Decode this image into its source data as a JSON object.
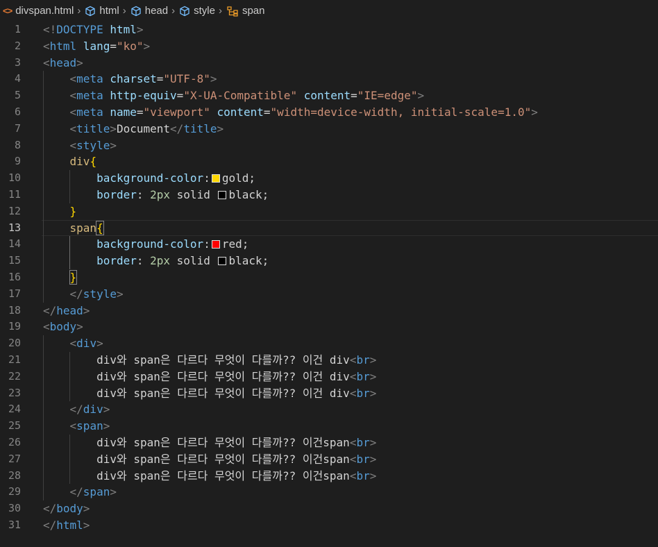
{
  "breadcrumb": {
    "file": "divspan.html",
    "items": [
      "html",
      "head",
      "style",
      "span"
    ]
  },
  "lines": [
    {
      "n": "1",
      "tokens": [
        [
          "t",
          "<!"
        ],
        [
          "tag",
          "DOCTYPE"
        ],
        [
          "attr",
          " html"
        ],
        [
          "t",
          ">"
        ]
      ]
    },
    {
      "n": "2",
      "tokens": [
        [
          "t",
          "<"
        ],
        [
          "tag",
          "html"
        ],
        [
          "attr",
          " lang"
        ],
        [
          "txt",
          "="
        ],
        [
          "str",
          "\"ko\""
        ],
        [
          "t",
          ">"
        ]
      ]
    },
    {
      "n": "3",
      "tokens": [
        [
          "t",
          "<"
        ],
        [
          "tag",
          "head"
        ],
        [
          "t",
          ">"
        ]
      ]
    },
    {
      "n": "4",
      "tokens": [
        [
          "txt",
          "    "
        ],
        [
          "t",
          "<"
        ],
        [
          "tag",
          "meta"
        ],
        [
          "attr",
          " charset"
        ],
        [
          "txt",
          "="
        ],
        [
          "str",
          "\"UTF-8\""
        ],
        [
          "t",
          ">"
        ]
      ]
    },
    {
      "n": "5",
      "tokens": [
        [
          "txt",
          "    "
        ],
        [
          "t",
          "<"
        ],
        [
          "tag",
          "meta"
        ],
        [
          "attr",
          " http-equiv"
        ],
        [
          "txt",
          "="
        ],
        [
          "str",
          "\"X-UA-Compatible\""
        ],
        [
          "attr",
          " content"
        ],
        [
          "txt",
          "="
        ],
        [
          "str",
          "\"IE=edge\""
        ],
        [
          "t",
          ">"
        ]
      ]
    },
    {
      "n": "6",
      "tokens": [
        [
          "txt",
          "    "
        ],
        [
          "t",
          "<"
        ],
        [
          "tag",
          "meta"
        ],
        [
          "attr",
          " name"
        ],
        [
          "txt",
          "="
        ],
        [
          "str",
          "\"viewport\""
        ],
        [
          "attr",
          " content"
        ],
        [
          "txt",
          "="
        ],
        [
          "str",
          "\"width=device-width, initial-scale=1.0\""
        ],
        [
          "t",
          ">"
        ]
      ]
    },
    {
      "n": "7",
      "tokens": [
        [
          "txt",
          "    "
        ],
        [
          "t",
          "<"
        ],
        [
          "tag",
          "title"
        ],
        [
          "t",
          ">"
        ],
        [
          "txt",
          "Document"
        ],
        [
          "t",
          "</"
        ],
        [
          "tag",
          "title"
        ],
        [
          "t",
          ">"
        ]
      ]
    },
    {
      "n": "8",
      "tokens": [
        [
          "txt",
          "    "
        ],
        [
          "t",
          "<"
        ],
        [
          "tag",
          "style"
        ],
        [
          "t",
          ">"
        ]
      ]
    },
    {
      "n": "9",
      "tokens": [
        [
          "txt",
          "    "
        ],
        [
          "sel",
          "div"
        ],
        [
          "br1",
          "{"
        ]
      ]
    },
    {
      "n": "10",
      "tokens": [
        [
          "txt",
          "        "
        ],
        [
          "prop",
          "background-color"
        ],
        [
          "txt",
          ":"
        ],
        [
          "swatch",
          "#ffd700"
        ],
        [
          "txt",
          "gold;"
        ]
      ]
    },
    {
      "n": "11",
      "tokens": [
        [
          "txt",
          "        "
        ],
        [
          "prop",
          "border"
        ],
        [
          "txt",
          ": "
        ],
        [
          "num",
          "2px"
        ],
        [
          "txt",
          " solid "
        ],
        [
          "swatch",
          "#000000"
        ],
        [
          "txt",
          "black;"
        ]
      ]
    },
    {
      "n": "12",
      "tokens": [
        [
          "txt",
          "    "
        ],
        [
          "br1",
          "}"
        ]
      ]
    },
    {
      "n": "13",
      "tokens": [
        [
          "txt",
          "    "
        ],
        [
          "sel",
          "span"
        ],
        [
          "br1m",
          "{"
        ]
      ]
    },
    {
      "n": "14",
      "tokens": [
        [
          "txt",
          "        "
        ],
        [
          "prop",
          "background-color"
        ],
        [
          "txt",
          ":"
        ],
        [
          "swatch",
          "#ff0000"
        ],
        [
          "txt",
          "red;"
        ]
      ]
    },
    {
      "n": "15",
      "tokens": [
        [
          "txt",
          "        "
        ],
        [
          "prop",
          "border"
        ],
        [
          "txt",
          ": "
        ],
        [
          "num",
          "2px"
        ],
        [
          "txt",
          " solid "
        ],
        [
          "swatch",
          "#000000"
        ],
        [
          "txt",
          "black;"
        ]
      ]
    },
    {
      "n": "16",
      "tokens": [
        [
          "txt",
          "    "
        ],
        [
          "br1m",
          "}"
        ]
      ]
    },
    {
      "n": "17",
      "tokens": [
        [
          "txt",
          "    "
        ],
        [
          "t",
          "</"
        ],
        [
          "tag",
          "style"
        ],
        [
          "t",
          ">"
        ]
      ]
    },
    {
      "n": "18",
      "tokens": [
        [
          "t",
          "</"
        ],
        [
          "tag",
          "head"
        ],
        [
          "t",
          ">"
        ]
      ]
    },
    {
      "n": "19",
      "tokens": [
        [
          "t",
          "<"
        ],
        [
          "tag",
          "body"
        ],
        [
          "t",
          ">"
        ]
      ]
    },
    {
      "n": "20",
      "tokens": [
        [
          "txt",
          "    "
        ],
        [
          "t",
          "<"
        ],
        [
          "tag",
          "div"
        ],
        [
          "t",
          ">"
        ]
      ]
    },
    {
      "n": "21",
      "tokens": [
        [
          "txt",
          "        div와 span은 다르다 무엇이 다를까?? 이건 div"
        ],
        [
          "t",
          "<"
        ],
        [
          "tag",
          "br"
        ],
        [
          "t",
          ">"
        ]
      ]
    },
    {
      "n": "22",
      "tokens": [
        [
          "txt",
          "        div와 span은 다르다 무엇이 다를까?? 이건 div"
        ],
        [
          "t",
          "<"
        ],
        [
          "tag",
          "br"
        ],
        [
          "t",
          ">"
        ]
      ]
    },
    {
      "n": "23",
      "tokens": [
        [
          "txt",
          "        div와 span은 다르다 무엇이 다를까?? 이건 div"
        ],
        [
          "t",
          "<"
        ],
        [
          "tag",
          "br"
        ],
        [
          "t",
          ">"
        ]
      ]
    },
    {
      "n": "24",
      "tokens": [
        [
          "txt",
          "    "
        ],
        [
          "t",
          "</"
        ],
        [
          "tag",
          "div"
        ],
        [
          "t",
          ">"
        ]
      ]
    },
    {
      "n": "25",
      "tokens": [
        [
          "txt",
          "    "
        ],
        [
          "t",
          "<"
        ],
        [
          "tag",
          "span"
        ],
        [
          "t",
          ">"
        ]
      ]
    },
    {
      "n": "26",
      "tokens": [
        [
          "txt",
          "        div와 span은 다르다 무엇이 다를까?? 이건span"
        ],
        [
          "t",
          "<"
        ],
        [
          "tag",
          "br"
        ],
        [
          "t",
          ">"
        ]
      ]
    },
    {
      "n": "27",
      "tokens": [
        [
          "txt",
          "        div와 span은 다르다 무엇이 다를까?? 이건span"
        ],
        [
          "t",
          "<"
        ],
        [
          "tag",
          "br"
        ],
        [
          "t",
          ">"
        ]
      ]
    },
    {
      "n": "28",
      "tokens": [
        [
          "txt",
          "        div와 span은 다르다 무엇이 다를까?? 이건span"
        ],
        [
          "t",
          "<"
        ],
        [
          "tag",
          "br"
        ],
        [
          "t",
          ">"
        ]
      ]
    },
    {
      "n": "29",
      "tokens": [
        [
          "txt",
          "    "
        ],
        [
          "t",
          "</"
        ],
        [
          "tag",
          "span"
        ],
        [
          "t",
          ">"
        ]
      ]
    },
    {
      "n": "30",
      "tokens": [
        [
          "t",
          "</"
        ],
        [
          "tag",
          "body"
        ],
        [
          "t",
          ">"
        ]
      ]
    },
    {
      "n": "31",
      "tokens": [
        [
          "t",
          "</"
        ],
        [
          "tag",
          "html"
        ],
        [
          "t",
          ">"
        ]
      ]
    }
  ],
  "current_line": "13",
  "colors": {
    "background": "#1e1e1e",
    "tag": "#569cd6",
    "attribute": "#9cdcfe",
    "string": "#ce9178",
    "selector": "#d7ba7d",
    "number": "#b5cea8",
    "bracket": "#ffd700"
  }
}
